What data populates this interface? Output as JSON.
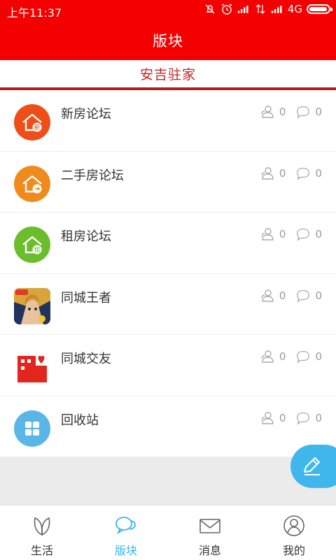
{
  "status_bar": {
    "time": "上午11:37",
    "network": "4G",
    "battery_level": 0.95
  },
  "header": {
    "title": "版块"
  },
  "section_tab": {
    "label": "安吉驻家"
  },
  "forums": [
    {
      "name": "新房论坛",
      "users": "0",
      "comments": "0",
      "icon": "new-house-icon",
      "color": "#f04e18",
      "badge": "新"
    },
    {
      "name": "二手房论坛",
      "users": "0",
      "comments": "0",
      "icon": "second-hand-house-icon",
      "color": "#f08a1d",
      "badge": ""
    },
    {
      "name": "租房论坛",
      "users": "0",
      "comments": "0",
      "icon": "rental-house-icon",
      "color": "#6cbd2c",
      "badge": "租"
    },
    {
      "name": "同城王者",
      "users": "0",
      "comments": "0",
      "icon": "game-hero-icon",
      "color": "#2a3a6a",
      "badge": ""
    },
    {
      "name": "同城交友",
      "users": "0",
      "comments": "0",
      "icon": "building-heart-icon",
      "color": "#e2261d",
      "badge": ""
    },
    {
      "name": "回收站",
      "users": "0",
      "comments": "0",
      "icon": "grid-icon",
      "color": "#5bb6e8",
      "badge": ""
    }
  ],
  "compose": {
    "icon": "pencil-icon",
    "color": "#3fb7ec"
  },
  "bottom_nav": {
    "items": [
      {
        "label": "生活",
        "icon": "leaf-icon"
      },
      {
        "label": "版块",
        "icon": "chat-bubbles-icon"
      },
      {
        "label": "消息",
        "icon": "envelope-icon"
      },
      {
        "label": "我的",
        "icon": "user-icon"
      }
    ],
    "active_index": 1,
    "active_color": "#39b4ec"
  }
}
